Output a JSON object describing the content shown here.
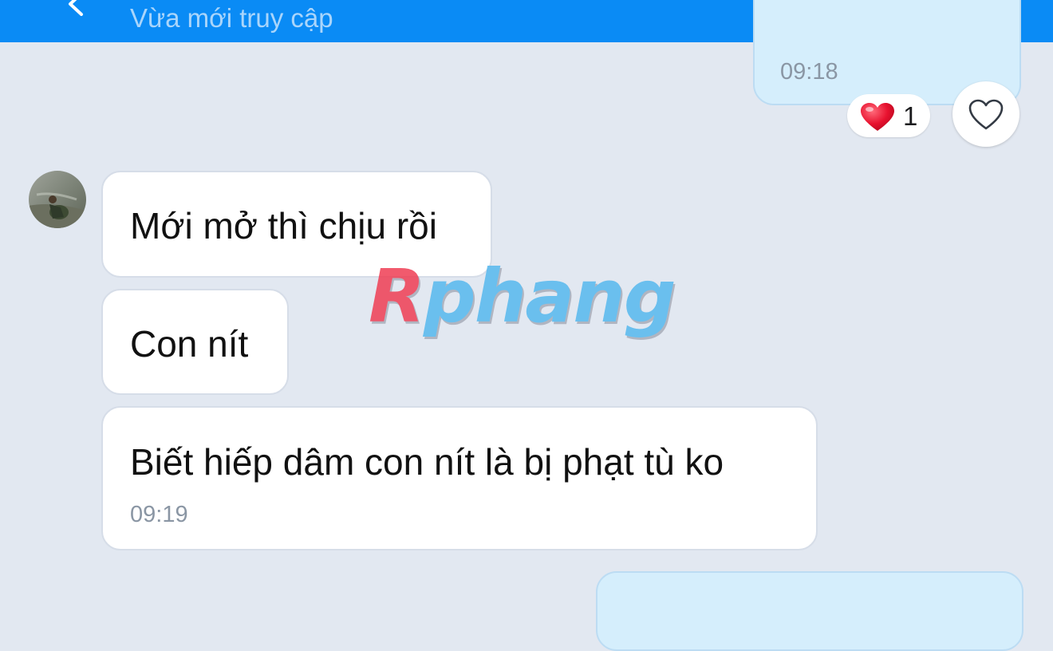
{
  "header": {
    "subtitle": "Vừa mới truy cập",
    "background_color": "#0a8bf5",
    "icons": [
      "back-icon",
      "call-icon",
      "video-call-icon",
      "menu-icon"
    ]
  },
  "messages": [
    {
      "direction": "outgoing",
      "time": "09:18",
      "reaction": {
        "icon": "heart-icon",
        "count": "1"
      }
    },
    {
      "direction": "incoming",
      "text": "Mới mở thì chịu rồi"
    },
    {
      "direction": "incoming",
      "text": "Con nít"
    },
    {
      "direction": "incoming",
      "text": "Biết hiếp dâm con nít là bị phạt tù ko",
      "time": "09:19"
    },
    {
      "direction": "outgoing"
    }
  ],
  "watermark": {
    "first": "R",
    "rest": "phang"
  },
  "colors": {
    "chat_background": "#e2e8f1",
    "outgoing_bubble": "#d5eefc",
    "incoming_bubble": "#ffffff",
    "heart": "#e8122f"
  }
}
